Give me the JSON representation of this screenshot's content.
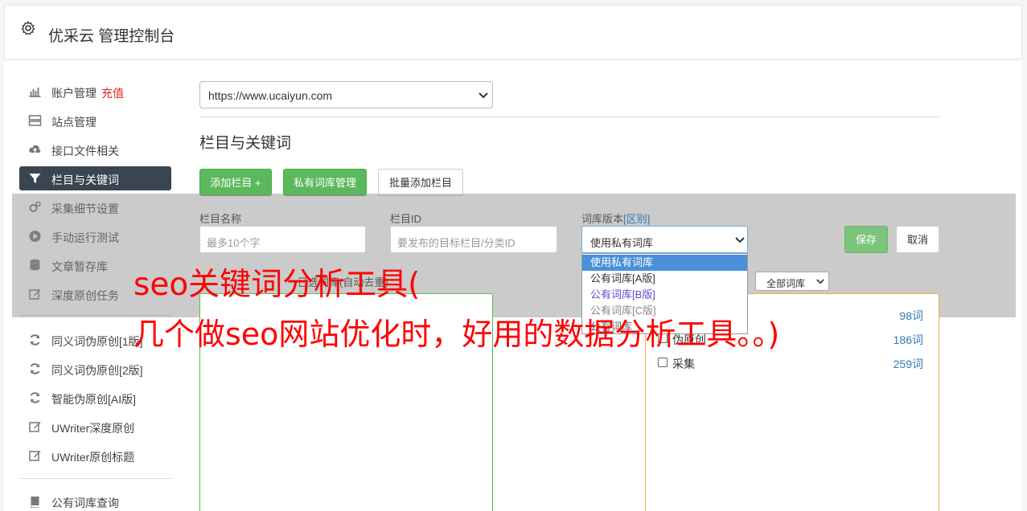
{
  "header": {
    "title": "优采云 管理控制台",
    "icon": "gear-icon"
  },
  "sidebar": {
    "items": [
      {
        "label": "账户管理",
        "badge": "充值",
        "icon": "bar-chart-icon",
        "top": 0
      },
      {
        "label": "站点管理",
        "icon": "server-icon"
      },
      {
        "label": "接口文件相关",
        "icon": "cloud-upload-icon"
      },
      {
        "label": "栏目与关键词",
        "icon": "filter-icon",
        "active": true
      },
      {
        "label": "采集细节设置",
        "icon": "cogs-icon"
      },
      {
        "label": "手动运行测试",
        "icon": "play-circle-icon"
      },
      {
        "label": "文章暂存库",
        "icon": "database-icon"
      },
      {
        "label": "深度原创任务",
        "icon": "edit-icon"
      },
      {
        "label": "同义词伪原创[1版]",
        "icon": "refresh-icon"
      },
      {
        "label": "同义词伪原创[2版]",
        "icon": "refresh-icon"
      },
      {
        "label": "智能伪原创[AI版]",
        "icon": "refresh-icon"
      },
      {
        "label": "UWriter深度原创",
        "icon": "edit-icon"
      },
      {
        "label": "UWriter原创标题",
        "icon": "edit-icon"
      },
      {
        "label": "公有词库查询",
        "icon": "book-icon"
      }
    ]
  },
  "site_select": {
    "value": "https://www.ucaiyun.com"
  },
  "section_title": "栏目与关键词",
  "toolbar": {
    "add_column": "添加栏目 +",
    "private_lib": "私有词库管理",
    "batch_add": "批量添加栏目"
  },
  "form": {
    "column_name_label": "栏目名称",
    "column_name_placeholder": "最多10个字",
    "column_id_label": "栏目ID",
    "column_id_placeholder": "要发布的目标栏目/分类ID",
    "lib_version_label": "词库版本",
    "lib_version_link": "[区别]",
    "lib_version_value": "使用私有词库",
    "lib_options": [
      "使用私有词库",
      "公有词库[A版]",
      "公有词库[B版]",
      "公有词库[C版]",
      "公有词库"
    ],
    "save": "保存",
    "cancel": "取消"
  },
  "selected_label": "已选词库(自动去重)",
  "lib_filter": {
    "value": "全部词库"
  },
  "libraries": [
    {
      "name": "",
      "count": "98词"
    },
    {
      "name": "伪原创",
      "count": "186词"
    },
    {
      "name": "采集",
      "count": "259词"
    }
  ],
  "watermark": {
    "line1": "seo关键词分析工具(",
    "line2": "几个做seo网站优化时，好用的数据分析工具。。)"
  },
  "colors": {
    "accent_green": "#5cb85c",
    "active_nav": "#3a4552",
    "watermark": "#ff0000",
    "highlight": "#4a90d9"
  }
}
